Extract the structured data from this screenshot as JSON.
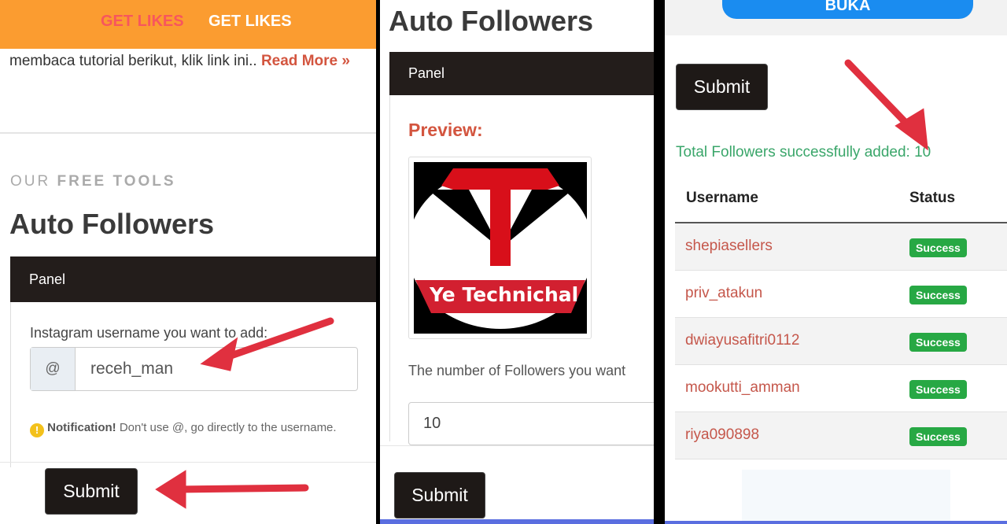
{
  "left": {
    "tabs": [
      {
        "label": "GET LIKES",
        "color": "#f7565d"
      },
      {
        "label": "GET LIKES",
        "color": "#ffffff"
      }
    ],
    "intro_text": "membaca tutorial berikut, klik link ini..",
    "read_more": "Read More »",
    "section_kicker_1": "OUR",
    "section_kicker_2": "FREE TOOLS",
    "title": "Auto Followers",
    "panel_label": "Panel",
    "field_label": "Instagram username you want to add:",
    "addon": "@",
    "username_value": "receh_man",
    "notice_bold": "Notification!",
    "notice_text": "Don't use @, go directly to the username.",
    "submit": "Submit"
  },
  "middle": {
    "title": "Auto Followers",
    "panel_label": "Panel",
    "preview_label": "Preview:",
    "logo_text": "Ye Technichal",
    "count_label": "The number of Followers you want",
    "count_value": "10",
    "submit": "Submit"
  },
  "right": {
    "top_button": "BUKA",
    "submit": "Submit",
    "result_text": "Total Followers successfully added: 10",
    "headers": [
      "Username",
      "Status"
    ],
    "rows": [
      {
        "username": "shepiasellers",
        "status": "Success"
      },
      {
        "username": "priv_atakun",
        "status": "Success"
      },
      {
        "username": "dwiayusafitri0112",
        "status": "Success"
      },
      {
        "username": "mookutti_amman",
        "status": "Success"
      },
      {
        "username": "riya090898",
        "status": "Success"
      }
    ]
  },
  "colors": {
    "accent_orange": "#fb9c30",
    "link": "#d3553f",
    "success": "#27a844",
    "arrow": "#e0303f",
    "button_blue": "#1a8cf0"
  }
}
